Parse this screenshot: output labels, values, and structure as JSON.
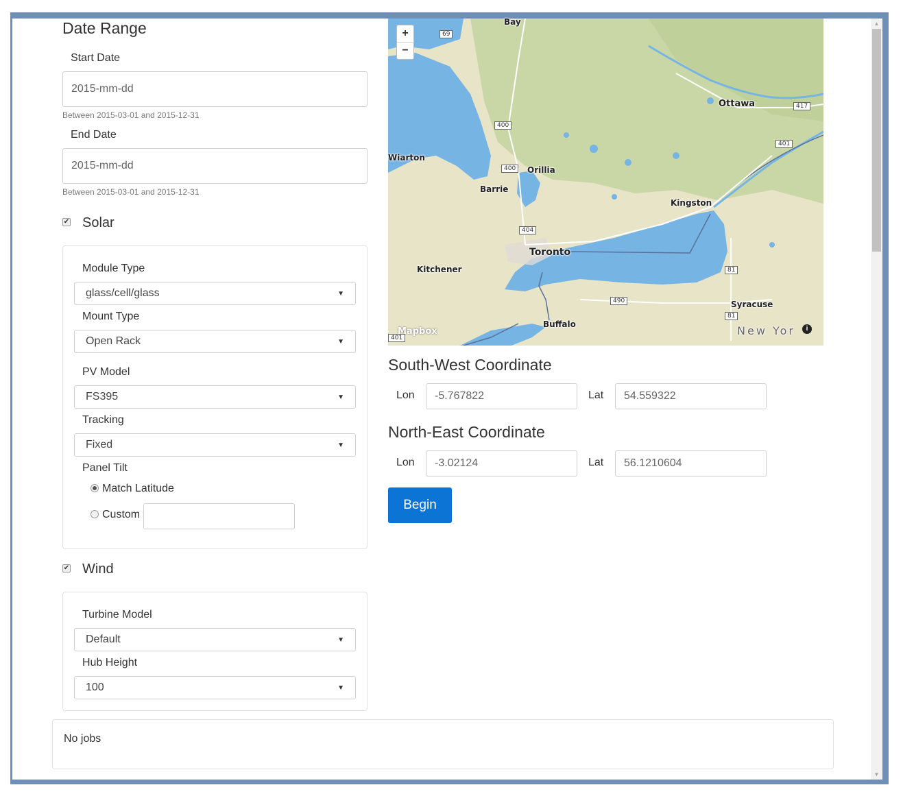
{
  "date_range": {
    "title": "Date Range",
    "start_label": "Start Date",
    "start_placeholder": "2015-mm-dd",
    "start_help": "Between 2015-03-01 and 2015-12-31",
    "end_label": "End Date",
    "end_placeholder": "2015-mm-dd",
    "end_help": "Between 2015-03-01 and 2015-12-31"
  },
  "solar": {
    "checkbox_label": "Solar",
    "checked": true,
    "module_type_label": "Module Type",
    "module_type_value": "glass/cell/glass",
    "mount_type_label": "Mount Type",
    "mount_type_value": "Open Rack",
    "pv_model_label": "PV Model",
    "pv_model_value": "FS395",
    "tracking_label": "Tracking",
    "tracking_value": "Fixed",
    "panel_tilt_label": "Panel Tilt",
    "tilt_option_match": "Match Latitude",
    "tilt_option_custom": "Custom",
    "tilt_selected": "Match Latitude",
    "custom_value": ""
  },
  "wind": {
    "checkbox_label": "Wind",
    "checked": true,
    "turbine_model_label": "Turbine Model",
    "turbine_model_value": "Default",
    "hub_height_label": "Hub Height",
    "hub_height_value": "100"
  },
  "map": {
    "zoom_in": "+",
    "zoom_out": "−",
    "attribution": "Mapbox",
    "info_icon": "info-icon",
    "places": {
      "bay": "Bay",
      "ottawa": "Ottawa",
      "wiarton": "Wiarton",
      "orillia": "Orillia",
      "barrie": "Barrie",
      "kingston": "Kingston",
      "toronto": "Toronto",
      "kitchener": "Kitchener",
      "syracuse": "Syracuse",
      "buffalo": "Buffalo",
      "new_york": "New Yor"
    },
    "shields": {
      "s69": "69",
      "s400a": "400",
      "s400b": "400",
      "s417": "417",
      "s401a": "401",
      "s404": "404",
      "s490": "490",
      "s81a": "81",
      "s81b": "81",
      "s401b": "401"
    }
  },
  "sw": {
    "title": "South-West Coordinate",
    "lon_label": "Lon",
    "lon_value": "-5.767822",
    "lat_label": "Lat",
    "lat_value": "54.559322"
  },
  "ne": {
    "title": "North-East Coordinate",
    "lon_label": "Lon",
    "lon_value": "-3.02124",
    "lat_label": "Lat",
    "lat_value": "56.1210604"
  },
  "begin_label": "Begin",
  "jobs_text": "No jobs",
  "colors": {
    "primary": "#0c74d4",
    "water": "#76b4e4",
    "land": "#e6e3c9",
    "forest": "#c9d7a6"
  }
}
